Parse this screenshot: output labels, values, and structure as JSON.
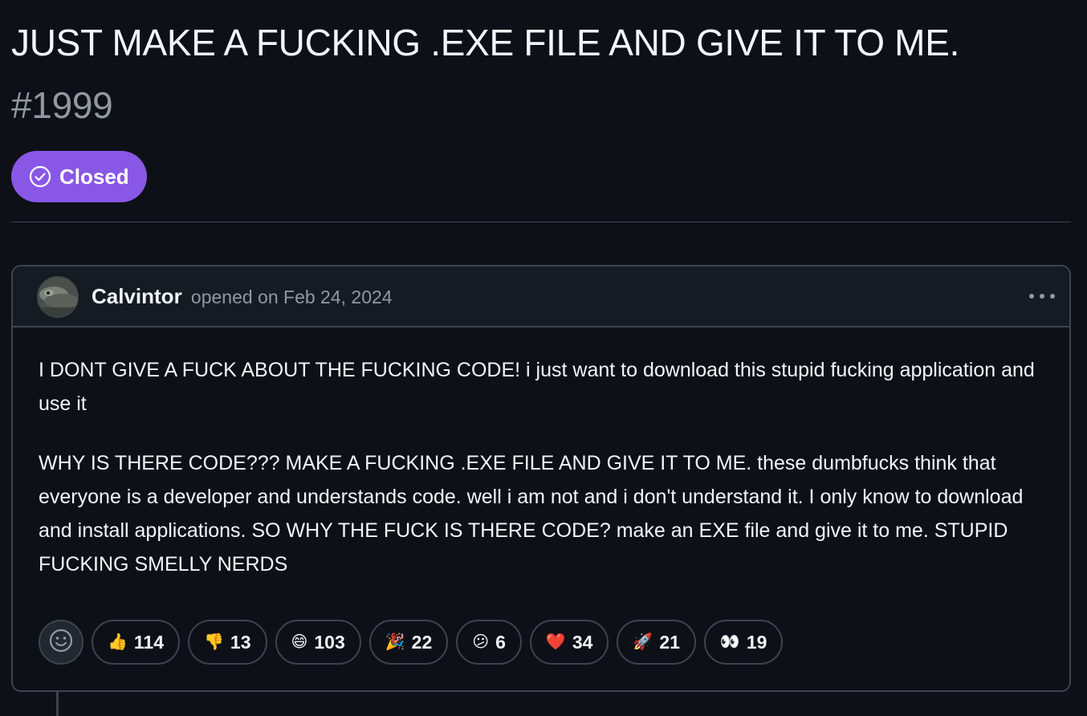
{
  "issue": {
    "title": "JUST MAKE A FUCKING .EXE FILE AND GIVE IT TO ME.",
    "number": "#1999",
    "state": "Closed"
  },
  "comment": {
    "author": "Calvintor",
    "opened_text": "opened on Feb 24, 2024",
    "paragraphs": [
      "I DONT GIVE A FUCK ABOUT THE FUCKING CODE! i just want to download this stupid fucking application and use it",
      "WHY IS THERE CODE??? MAKE A FUCKING .EXE FILE AND GIVE IT TO ME. these dumbfucks think that everyone is a developer and understands code. well i am not and i don't understand it. I only know to download and install applications. SO WHY THE FUCK IS THERE CODE? make an EXE file and give it to me. STUPID FUCKING SMELLY NERDS"
    ],
    "reactions": [
      {
        "emoji": "👍",
        "count": "114"
      },
      {
        "emoji": "👎",
        "count": "13"
      },
      {
        "emoji": "😄",
        "count": "103"
      },
      {
        "emoji": "🎉",
        "count": "22"
      },
      {
        "emoji": "😕",
        "count": "6"
      },
      {
        "emoji": "❤️",
        "count": "34"
      },
      {
        "emoji": "🚀",
        "count": "21"
      },
      {
        "emoji": "👀",
        "count": "19"
      }
    ]
  },
  "colors": {
    "background": "#0d1117",
    "closed_badge": "#8957e5",
    "border": "#3d444d",
    "muted_text": "#9198a1"
  },
  "icons": {
    "state": "check-circle-icon",
    "more": "kebab-horizontal-icon",
    "add_reaction": "smiley-icon"
  }
}
